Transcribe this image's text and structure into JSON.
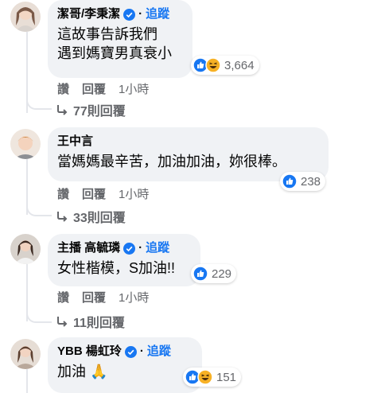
{
  "comments": [
    {
      "name": "潔哥/李秉潔",
      "verified": true,
      "follow_label": "追蹤",
      "text_lines": [
        "這故事告訴我們",
        "遇到媽寶男真衰小"
      ],
      "reaction_count": "3,664",
      "reactions": [
        "like-icon",
        "haha-icon"
      ],
      "actions": [
        "讚",
        "回覆",
        "1小時"
      ],
      "replies_label": "77則回覆"
    },
    {
      "name": "王中言",
      "verified": false,
      "text_lines": [
        "當媽媽最辛苦，加油加油，妳很棒。"
      ],
      "reaction_count": "238",
      "reactions": [
        "like-icon"
      ],
      "actions": [
        "讚",
        "回覆",
        "1小時"
      ],
      "replies_label": "33則回覆"
    },
    {
      "name": "主播 高毓璘",
      "verified": true,
      "follow_label": "追蹤",
      "text_lines": [
        "女性楷模，S加油!!"
      ],
      "reaction_count": "229",
      "reactions": [
        "like-icon"
      ],
      "actions": [
        "讚",
        "回覆",
        "1小時"
      ],
      "replies_label": "11則回覆"
    },
    {
      "name": "YBB 楊虹玲",
      "verified": true,
      "follow_label": "追蹤",
      "text_lines": [
        "加油 🙏"
      ],
      "reaction_count": "151",
      "reactions": [
        "like-icon",
        "haha-icon"
      ]
    }
  ],
  "colors": {
    "accent": "#1877f2",
    "bubble": "#f0f2f5",
    "meta": "#65676b"
  }
}
